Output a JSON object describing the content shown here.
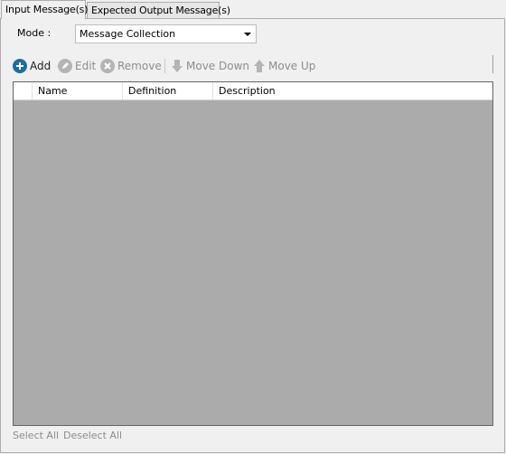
{
  "tabs": [
    {
      "label": "Input Message(s)",
      "active": true
    },
    {
      "label": "Expected Output Message(s)",
      "active": false
    }
  ],
  "mode": {
    "label": "Mode :",
    "selected": "Message Collection"
  },
  "toolbar": {
    "add": "Add",
    "edit": "Edit",
    "remove": "Remove",
    "move_down": "Move Down",
    "move_up": "Move Up"
  },
  "grid": {
    "columns": [
      "",
      "Name",
      "Definition",
      "Description"
    ],
    "rows": []
  },
  "footer": {
    "select_all": "Select All",
    "deselect_all": "Deselect All"
  },
  "colors": {
    "accent": "#1b6ea0",
    "disabled": "#8d8d8d",
    "grid_bg": "#ababab"
  }
}
